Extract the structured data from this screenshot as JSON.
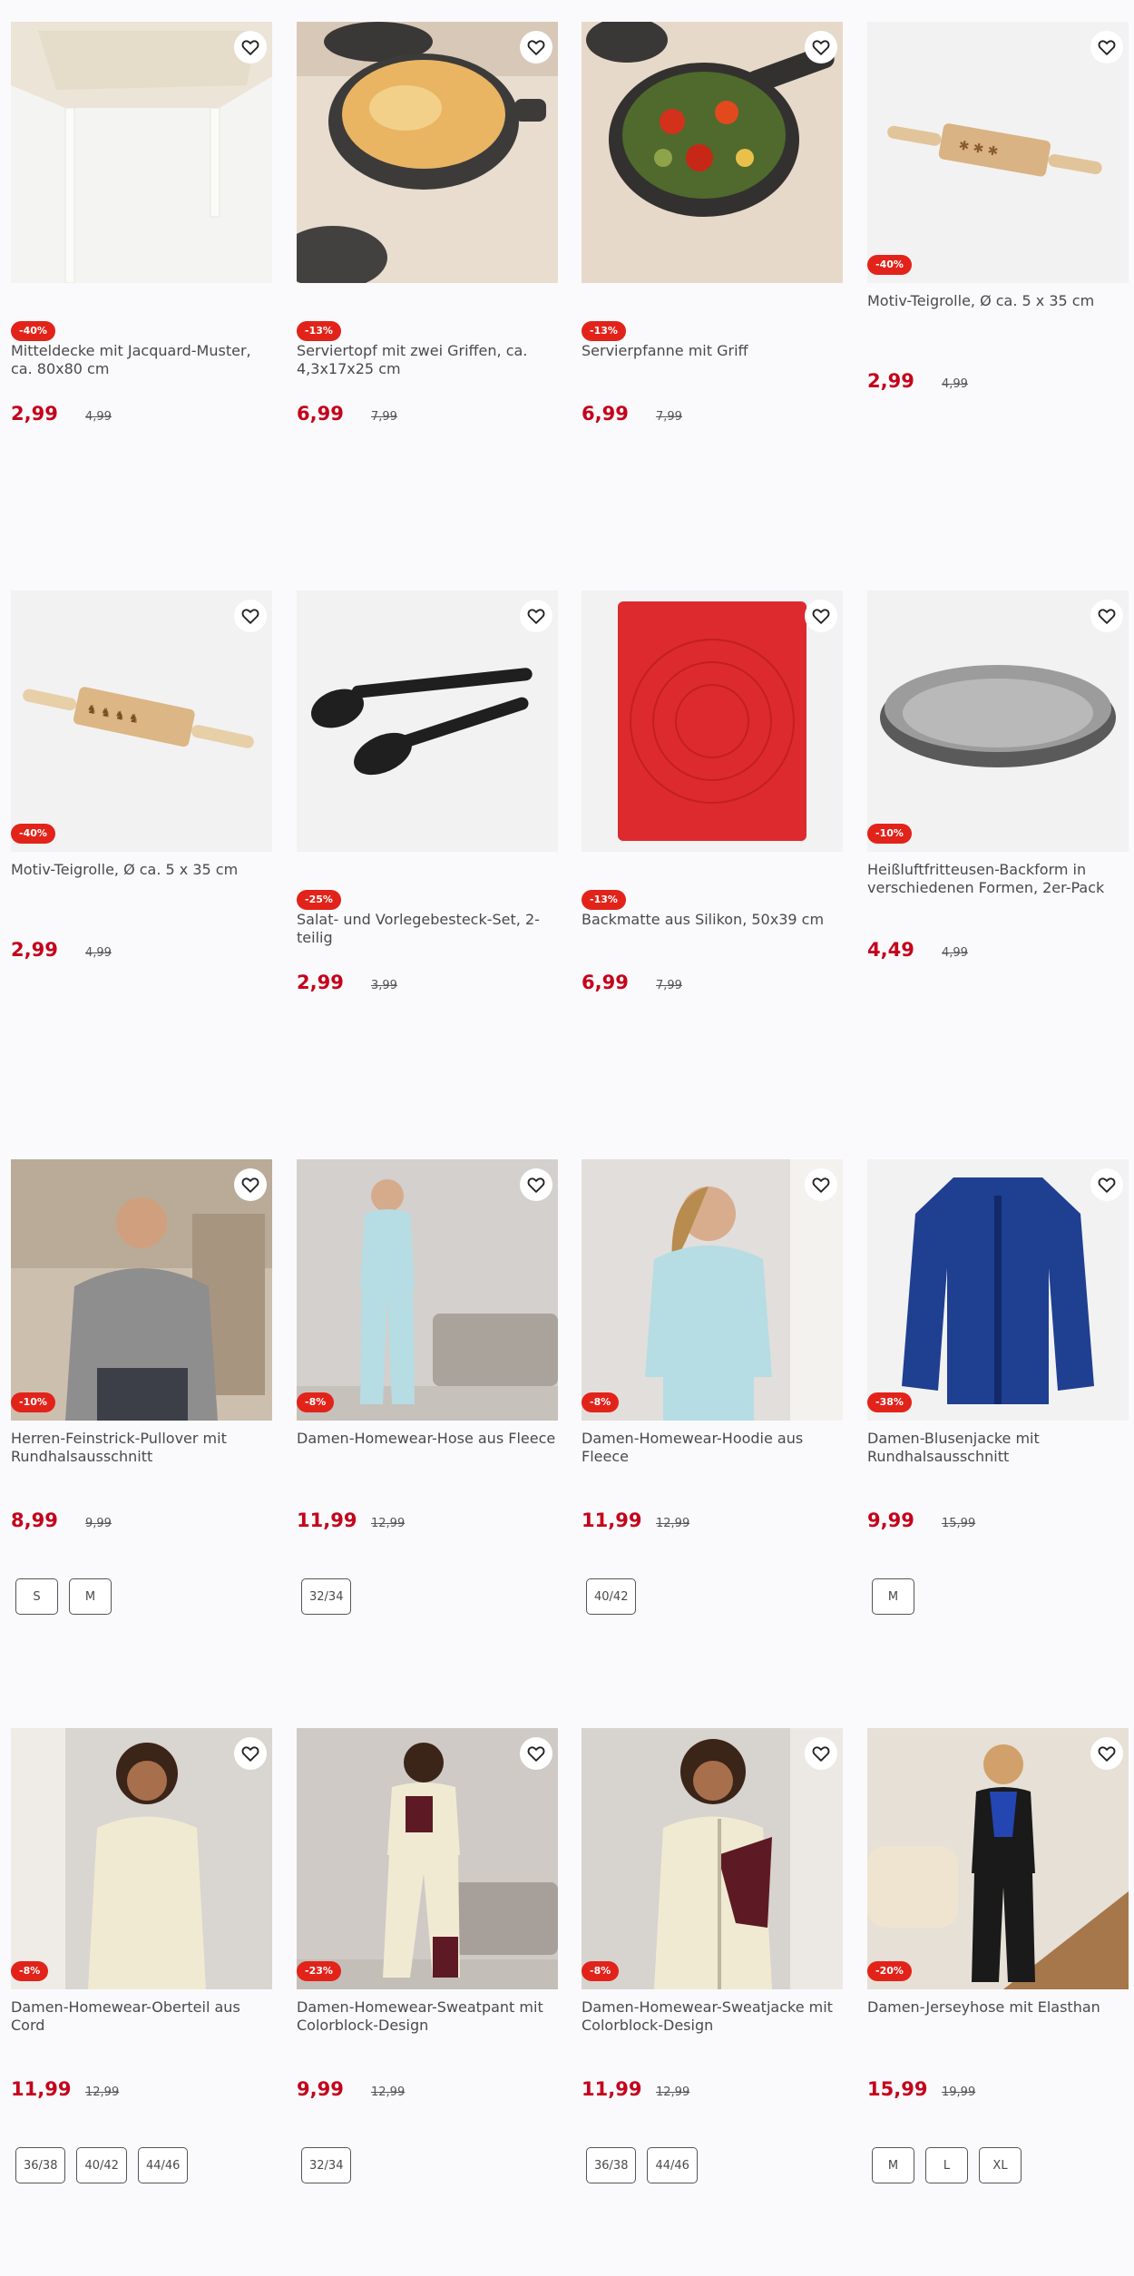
{
  "colors": {
    "price": "#c5031b",
    "badge": "#e2231a"
  },
  "products": [
    {
      "title": "Mitteldecke mit Jacquard-Muster, ca. 80x80 cm",
      "badge": "-40%",
      "price": "2,99",
      "old_price": "4,99",
      "sizes": [],
      "image": "tablecloth",
      "favorite_icon": "heart-outline-icon"
    },
    {
      "title": "Serviertopf mit zwei Griffen, ca. 4,3x17x25 cm",
      "badge": "-13%",
      "price": "6,99",
      "old_price": "7,99",
      "sizes": [],
      "image": "casserole-pot",
      "favorite_icon": "heart-outline-icon"
    },
    {
      "title": "Servierpfanne mit Griff",
      "badge": "-13%",
      "price": "6,99",
      "old_price": "7,99",
      "sizes": [],
      "image": "serving-pan",
      "favorite_icon": "heart-outline-icon"
    },
    {
      "title": "Motiv-Teigrolle, Ø ca. 5 x 35 cm",
      "badge": "-40%",
      "price": "2,99",
      "old_price": "4,99",
      "sizes": [],
      "image": "rolling-pin-stars",
      "favorite_icon": "heart-outline-icon"
    },
    {
      "title": "Motiv-Teigrolle, Ø ca. 5 x 35 cm",
      "badge": "-40%",
      "price": "2,99",
      "old_price": "4,99",
      "sizes": [],
      "image": "rolling-pin-reindeer",
      "favorite_icon": "heart-outline-icon"
    },
    {
      "title": "Salat- und Vorlegebesteck-Set, 2-teilig",
      "badge": "-25%",
      "price": "2,99",
      "old_price": "3,99",
      "sizes": [],
      "image": "serving-tongs",
      "favorite_icon": "heart-outline-icon"
    },
    {
      "title": "Backmatte aus Silikon, 50x39 cm",
      "badge": "-13%",
      "price": "6,99",
      "old_price": "7,99",
      "sizes": [],
      "image": "baking-mat",
      "favorite_icon": "heart-outline-icon"
    },
    {
      "title": "Heißluftfritteusen-Backform in verschiedenen Formen, 2er-Pack",
      "badge": "-10%",
      "price": "4,49",
      "old_price": "4,99",
      "sizes": [],
      "image": "baking-tin",
      "favorite_icon": "heart-outline-icon"
    },
    {
      "title": "Herren-Feinstrick-Pullover mit Rundhalsausschnitt",
      "badge": "-10%",
      "price": "8,99",
      "old_price": "9,99",
      "sizes": [
        "S",
        "M"
      ],
      "image": "man-grey-sweater",
      "favorite_icon": "heart-outline-icon"
    },
    {
      "title": "Damen-Homewear-Hose aus Fleece",
      "badge": "-8%",
      "price": "11,99",
      "old_price": "12,99",
      "sizes": [
        "32/34"
      ],
      "image": "woman-fleece-pants",
      "favorite_icon": "heart-outline-icon"
    },
    {
      "title": "Damen-Homewear-Hoodie aus Fleece",
      "badge": "-8%",
      "price": "11,99",
      "old_price": "12,99",
      "sizes": [
        "40/42"
      ],
      "image": "woman-fleece-hoodie",
      "favorite_icon": "heart-outline-icon"
    },
    {
      "title": "Damen-Blusenjacke mit Rundhalsausschnitt",
      "badge": "-38%",
      "price": "9,99",
      "old_price": "15,99",
      "sizes": [
        "M"
      ],
      "image": "blue-jacket",
      "favorite_icon": "heart-outline-icon"
    },
    {
      "title": "Damen-Homewear-Oberteil aus Cord",
      "badge": "-8%",
      "price": "11,99",
      "old_price": "12,99",
      "sizes": [
        "36/38",
        "40/42",
        "44/46"
      ],
      "image": "woman-cord-top",
      "favorite_icon": "heart-outline-icon"
    },
    {
      "title": "Damen-Homewear-Sweatpant mit Colorblock-Design",
      "badge": "-23%",
      "price": "9,99",
      "old_price": "12,99",
      "sizes": [
        "32/34"
      ],
      "image": "woman-colorblock-pants",
      "favorite_icon": "heart-outline-icon"
    },
    {
      "title": "Damen-Homewear-Sweatjacke mit Colorblock-Design",
      "badge": "-8%",
      "price": "11,99",
      "old_price": "12,99",
      "sizes": [
        "36/38",
        "44/46"
      ],
      "image": "woman-colorblock-jacket",
      "favorite_icon": "heart-outline-icon"
    },
    {
      "title": "Damen-Jerseyhose mit Elasthan",
      "badge": "-20%",
      "price": "15,99",
      "old_price": "19,99",
      "sizes": [
        "M",
        "L",
        "XL"
      ],
      "image": "woman-jersey-pants",
      "favorite_icon": "heart-outline-icon"
    }
  ]
}
